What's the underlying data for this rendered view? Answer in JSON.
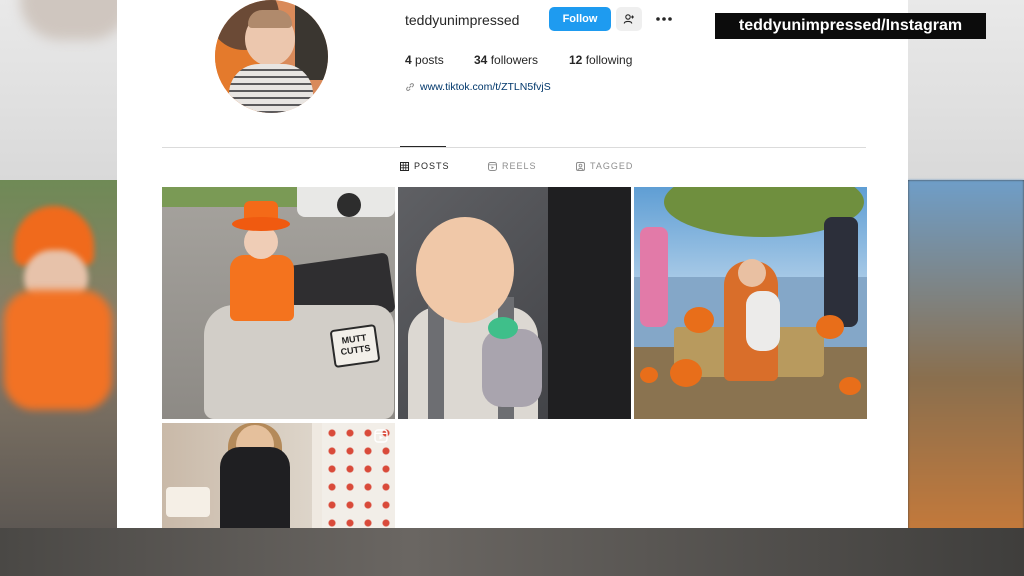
{
  "profile": {
    "username": "teddyunimpressed",
    "follow_label": "Follow",
    "adduser_icon": "person-add-icon",
    "more_icon": "more-horizontal-icon",
    "stats": {
      "posts_count": "4",
      "posts_label": "posts",
      "followers_count": "34",
      "followers_label": "followers",
      "following_count": "12",
      "following_label": "following"
    },
    "link_text": "www.tiktok.com/t/ZTLN5fvjS"
  },
  "tabs": [
    {
      "label": "POSTS",
      "icon": "grid-icon",
      "active": true
    },
    {
      "label": "REELS",
      "icon": "reels-icon",
      "active": false
    },
    {
      "label": "TAGGED",
      "icon": "tagged-icon",
      "active": false
    }
  ],
  "posts": [
    {
      "sign_text": "MUTT CUTTS"
    },
    {},
    {},
    {
      "type_icon": "reel-icon"
    }
  ],
  "watermark": "teddyunimpressed/Instagram",
  "colors": {
    "follow_blue": "#1e9bf0",
    "link_blue": "#00376b",
    "text": "#262626",
    "muted": "#8e8e8e"
  }
}
